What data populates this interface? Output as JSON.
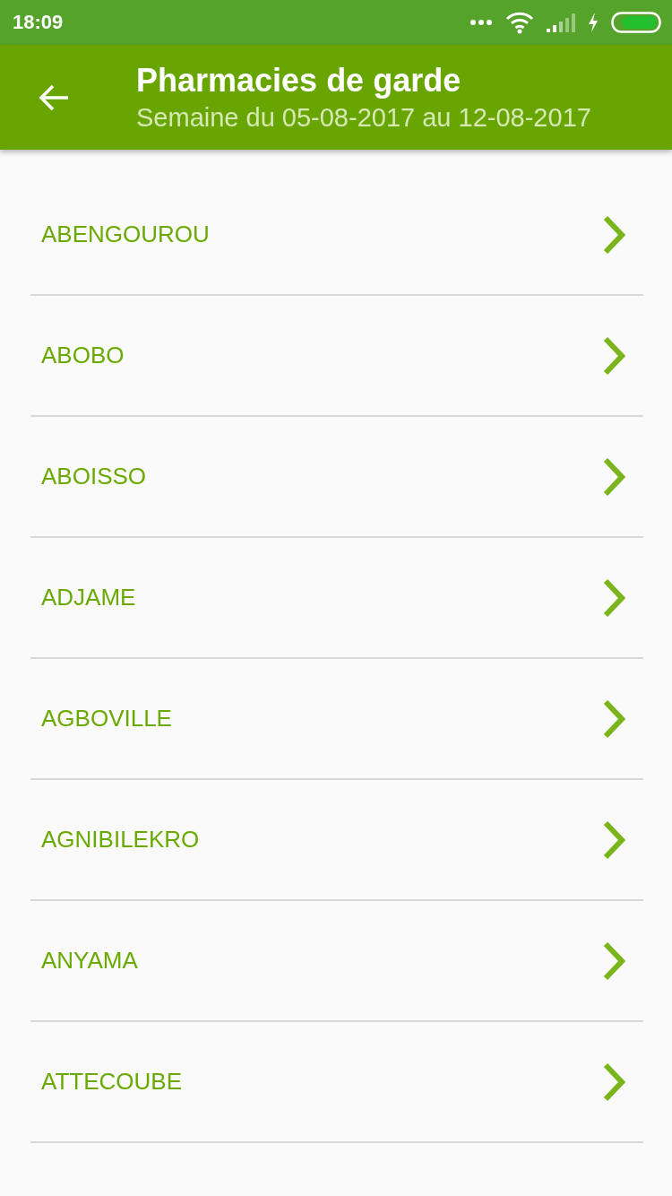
{
  "status_bar": {
    "time": "18:09"
  },
  "toolbar": {
    "title": "Pharmacies de garde",
    "subtitle": "Semaine du 05-08-2017 au 12-08-2017"
  },
  "cities": [
    {
      "name": "ABENGOUROU"
    },
    {
      "name": "ABOBO"
    },
    {
      "name": "ABOISSO"
    },
    {
      "name": "ADJAME"
    },
    {
      "name": "AGBOVILLE"
    },
    {
      "name": "AGNIBILEKRO"
    },
    {
      "name": "ANYAMA"
    },
    {
      "name": "ATTECOUBE"
    }
  ]
}
